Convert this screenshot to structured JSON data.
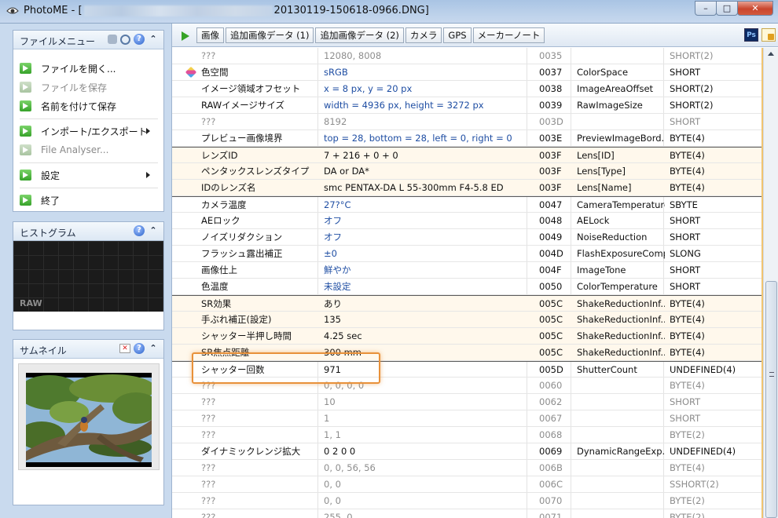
{
  "window": {
    "app_name": "PhotoME",
    "title_open": " - [",
    "file_name": "20130119-150618-0966.DNG]",
    "btn_min": "–",
    "btn_max": "□",
    "btn_close": "✕"
  },
  "file_menu": {
    "title": "ファイルメニュー",
    "items": [
      {
        "label": "ファイルを開く...",
        "enabled": true
      },
      {
        "label": "ファイルを保存",
        "enabled": false
      },
      {
        "label": "名前を付けて保存",
        "enabled": true
      },
      {
        "label": "インポート/エクスポート",
        "enabled": true
      },
      {
        "label": "File Analyser...",
        "enabled": false
      },
      {
        "label": "設定",
        "enabled": true
      },
      {
        "label": "終了",
        "enabled": true
      }
    ]
  },
  "histogram": {
    "title": "ヒストグラム",
    "mode": "RAW"
  },
  "thumbnail": {
    "title": "サムネイル"
  },
  "tabs": [
    "画像",
    "追加画像データ (1)",
    "追加画像データ (2)",
    "カメラ",
    "GPS",
    "メーカーノート"
  ],
  "toolbar": {
    "ps_label": "Ps"
  },
  "rows": [
    {
      "name": "???",
      "value": "12080, 8008",
      "tag": "0035",
      "key": "",
      "type": "SHORT(2)",
      "style": "dim"
    },
    {
      "name": "色空間",
      "value": "sRGB",
      "tag": "0037",
      "key": "ColorSpace",
      "type": "SHORT",
      "style": "blue",
      "icon": true
    },
    {
      "name": "イメージ領域オフセット",
      "value": "x = 8 px, y = 20 px",
      "tag": "0038",
      "key": "ImageAreaOffset",
      "type": "SHORT(2)",
      "style": "blue"
    },
    {
      "name": "RAWイメージサイズ",
      "value": "width = 4936 px, height = 3272 px",
      "tag": "0039",
      "key": "RawImageSize",
      "type": "SHORT(2)",
      "style": "blue"
    },
    {
      "name": "???",
      "value": "8192",
      "tag": "003D",
      "key": "",
      "type": "SHORT",
      "style": "dim"
    },
    {
      "name": "プレビュー画像境界",
      "value": "top = 28, bottom = 28, left = 0, right = 0",
      "tag": "003E",
      "key": "PreviewImageBord...",
      "type": "BYTE(4)",
      "style": "blue"
    },
    {
      "name": "レンズID",
      "value": "7 + 216 + 0 + 0",
      "tag": "003F",
      "key": "Lens[ID]",
      "type": "BYTE(4)",
      "style": "hl",
      "divtop": true
    },
    {
      "name": "ペンタックスレンズタイプ",
      "value": "DA or DA*",
      "tag": "003F",
      "key": "Lens[Type]",
      "type": "BYTE(4)",
      "style": "hl"
    },
    {
      "name": "IDのレンズ名",
      "value": "smc PENTAX-DA L 55-300mm F4-5.8 ED",
      "tag": "003F",
      "key": "Lens[Name]",
      "type": "BYTE(4)",
      "style": "hl"
    },
    {
      "name": "カメラ温度",
      "value": "27?°C",
      "tag": "0047",
      "key": "CameraTemperature",
      "type": "SBYTE",
      "style": "blue",
      "divtop": true
    },
    {
      "name": "AEロック",
      "value": "オフ",
      "tag": "0048",
      "key": "AELock",
      "type": "SHORT",
      "style": "blue"
    },
    {
      "name": "ノイズリダクション",
      "value": "オフ",
      "tag": "0049",
      "key": "NoiseReduction",
      "type": "SHORT",
      "style": "blue"
    },
    {
      "name": "フラッシュ露出補正",
      "value": "±0",
      "tag": "004D",
      "key": "FlashExposureComp",
      "type": "SLONG",
      "style": "blue"
    },
    {
      "name": "画像仕上",
      "value": "鮮やか",
      "tag": "004F",
      "key": "ImageTone",
      "type": "SHORT",
      "style": "blue"
    },
    {
      "name": "色温度",
      "value": "未設定",
      "tag": "0050",
      "key": "ColorTemperature",
      "type": "SHORT",
      "style": "blue"
    },
    {
      "name": "SR効果",
      "value": "あり",
      "tag": "005C",
      "key": "ShakeReductionInf...",
      "type": "BYTE(4)",
      "style": "hl",
      "divtop": true
    },
    {
      "name": "手ぶれ補正(設定)",
      "value": "135",
      "tag": "005C",
      "key": "ShakeReductionInf...",
      "type": "BYTE(4)",
      "style": "hl"
    },
    {
      "name": "シャッター半押し時間",
      "value": "4.25 sec",
      "tag": "005C",
      "key": "ShakeReductionInf...",
      "type": "BYTE(4)",
      "style": "hl"
    },
    {
      "name": "SR焦点距離",
      "value": "300 mm",
      "tag": "005C",
      "key": "ShakeReductionInf...",
      "type": "BYTE(4)",
      "style": "hl"
    },
    {
      "name": "シャッター回数",
      "value": "971",
      "tag": "005D",
      "key": "ShutterCount",
      "type": "UNDEFINED(4)",
      "style": "plain",
      "divtop": true
    },
    {
      "name": "???",
      "value": "0, 0, 0, 0",
      "tag": "0060",
      "key": "",
      "type": "BYTE(4)",
      "style": "dim"
    },
    {
      "name": "???",
      "value": "10",
      "tag": "0062",
      "key": "",
      "type": "SHORT",
      "style": "dim"
    },
    {
      "name": "???",
      "value": "1",
      "tag": "0067",
      "key": "",
      "type": "SHORT",
      "style": "dim"
    },
    {
      "name": "???",
      "value": "1, 1",
      "tag": "0068",
      "key": "",
      "type": "BYTE(2)",
      "style": "dim"
    },
    {
      "name": "ダイナミックレンジ拡大",
      "value": "0 2 0 0",
      "tag": "0069",
      "key": "DynamicRangeExp...",
      "type": "UNDEFINED(4)",
      "style": "plain"
    },
    {
      "name": "???",
      "value": "0, 0, 56, 56",
      "tag": "006B",
      "key": "",
      "type": "BYTE(4)",
      "style": "dim"
    },
    {
      "name": "???",
      "value": "0, 0",
      "tag": "006C",
      "key": "",
      "type": "SSHORT(2)",
      "style": "dim"
    },
    {
      "name": "???",
      "value": "0, 0",
      "tag": "0070",
      "key": "",
      "type": "BYTE(2)",
      "style": "dim"
    },
    {
      "name": "???",
      "value": "255, 0",
      "tag": "0071",
      "key": "",
      "type": "BYTE(2)",
      "style": "dim"
    }
  ]
}
